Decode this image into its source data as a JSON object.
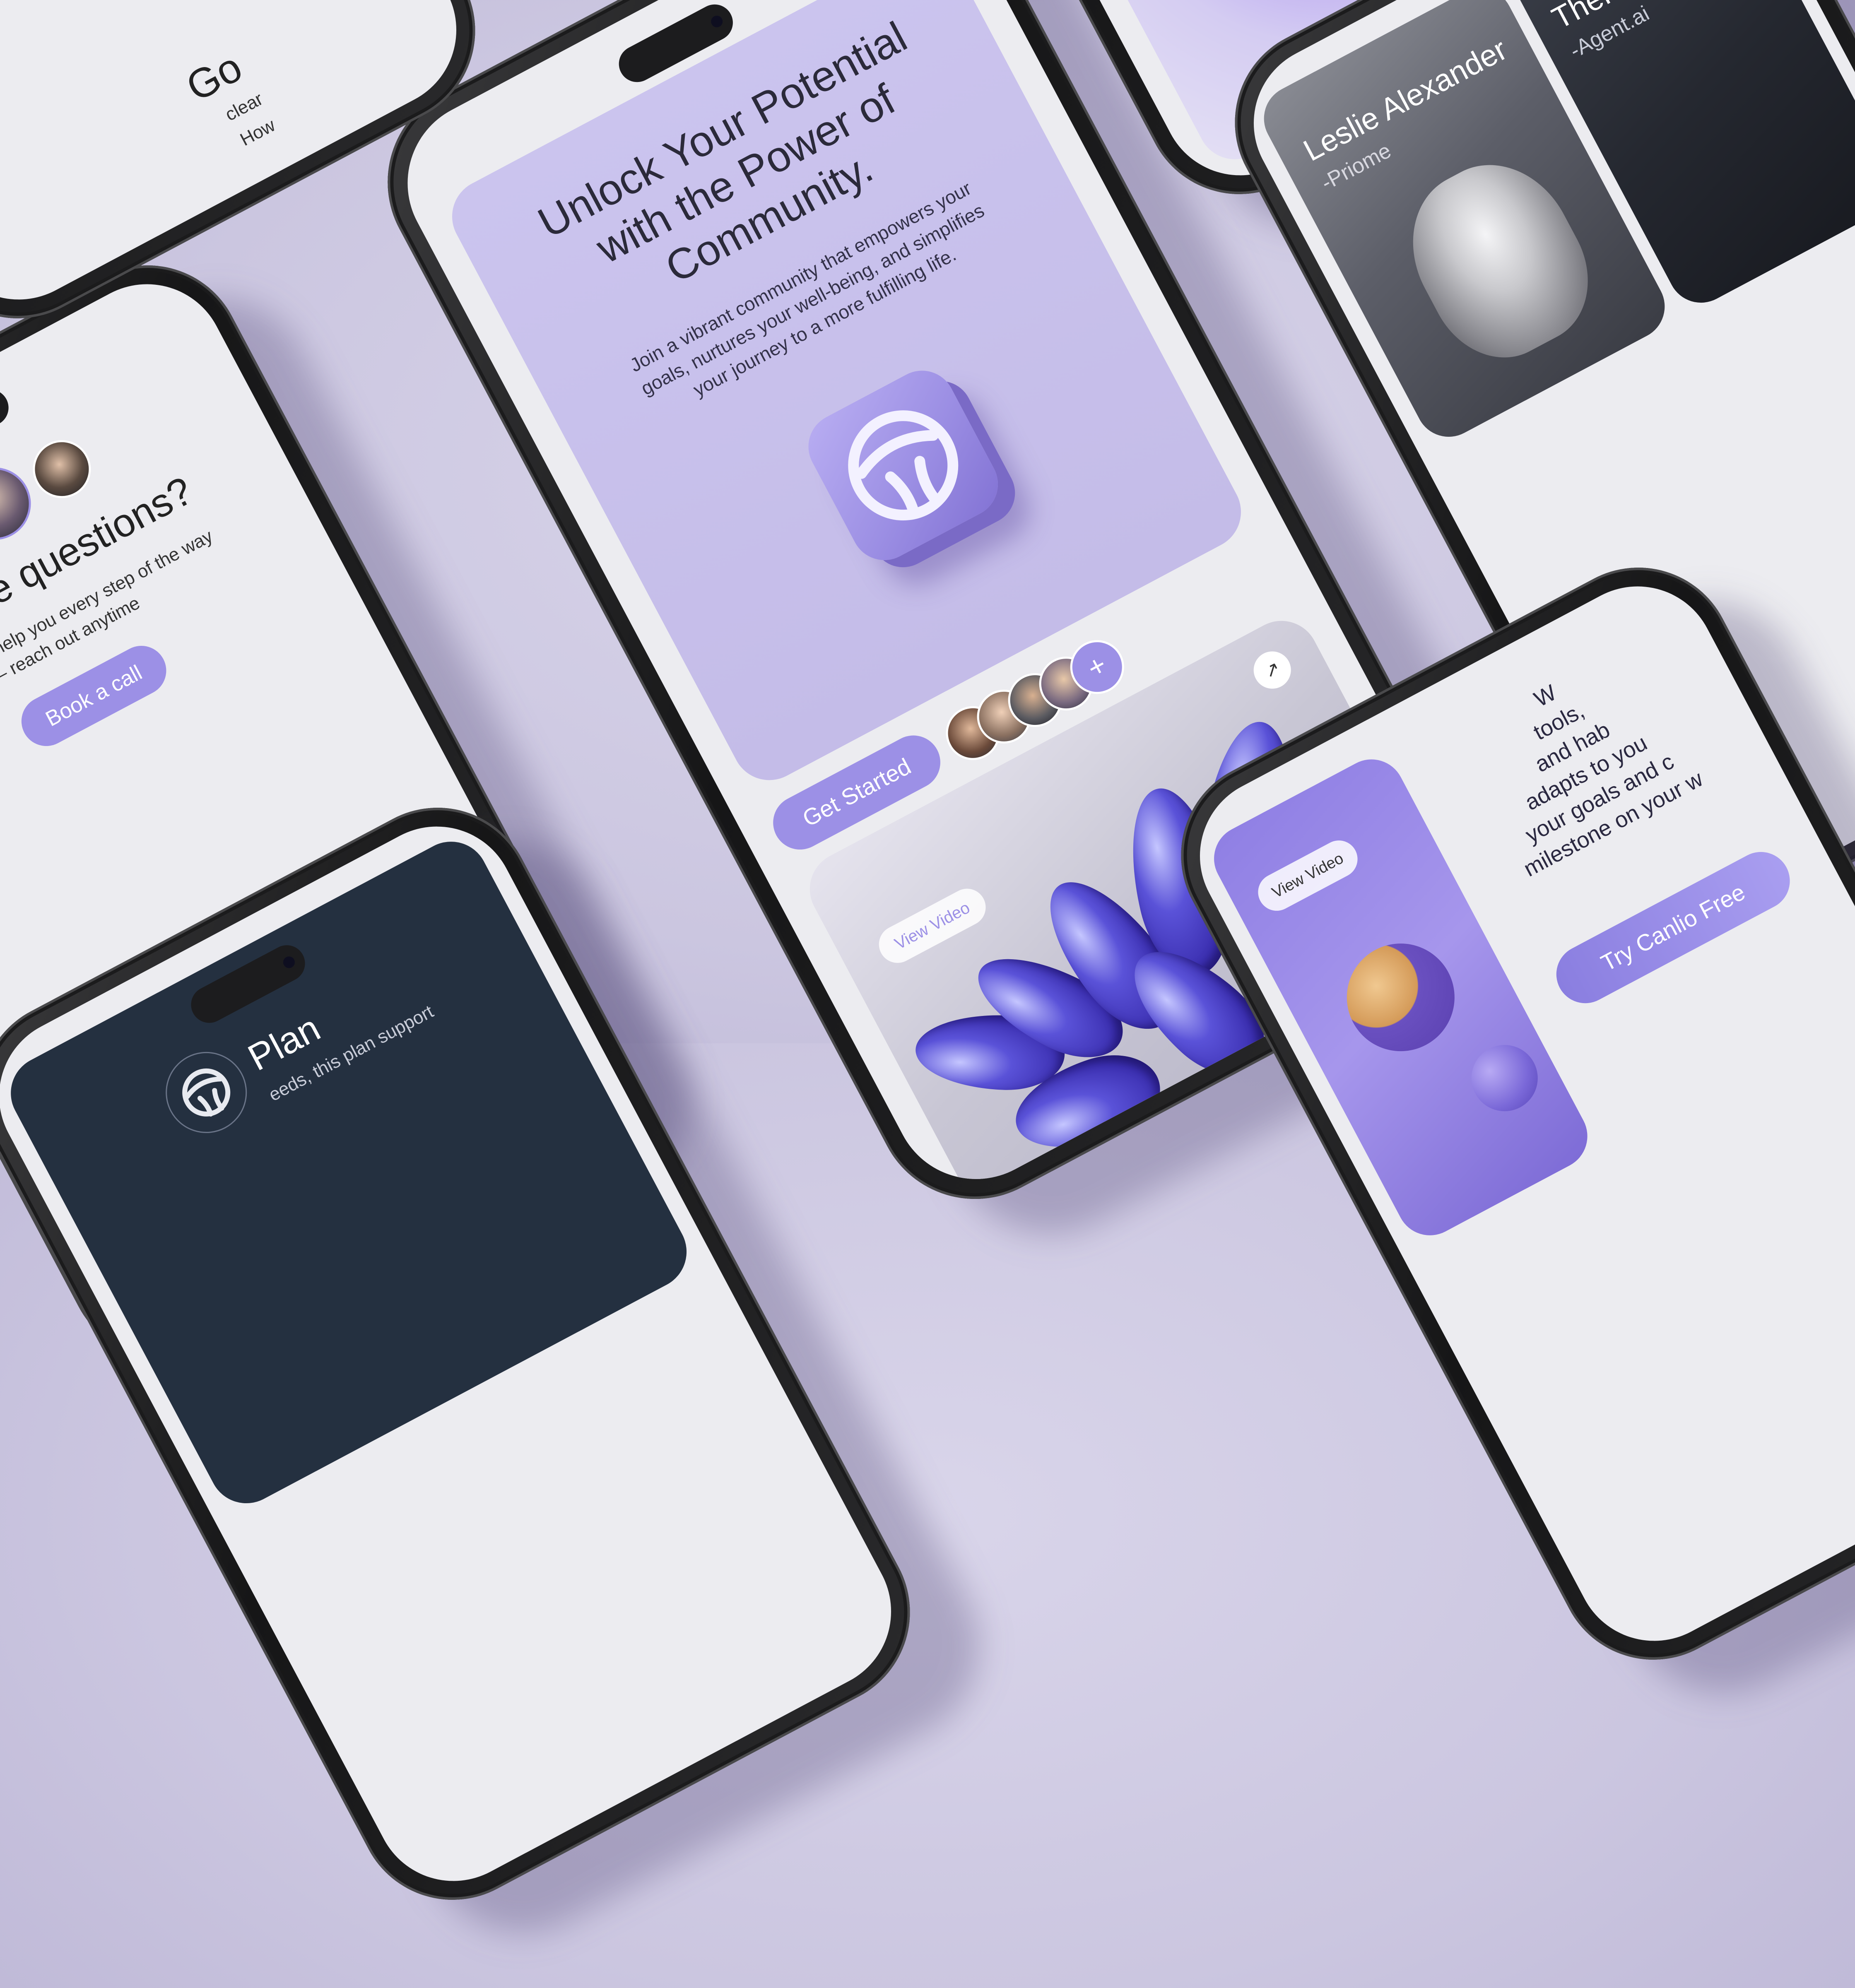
{
  "colors": {
    "background": "#cdc8e2",
    "accent": "#9c90e6",
    "card": "#c7c0ea",
    "screen": "#ececf0",
    "dark_screen": "#243040"
  },
  "center_phone": {
    "headline": "Unlock Your Potential with the Power of Community.",
    "subtext": "Join a vibrant community that empowers your goals, nurtures your well-being, and simplifies your journey to a more fulfilling life.",
    "cta_label": "Get Started",
    "add_label": "+",
    "view_video_label": "View Video",
    "arrow_label": "↗",
    "app_icon": "community-logo-icon"
  },
  "left_phone": {
    "heading": "Still have questions?",
    "subtext": "We're here to help you every step of the way — reach out anytime",
    "button_label": "Book a call"
  },
  "right_top_phone": {
    "card1_name": "Leslie Alexander",
    "card1_role": "-Priome",
    "card2_name": "Theresa Webb",
    "card2_role": "-Agent.ai"
  },
  "top_left_phone": {
    "text_1": "Go",
    "text_2": "clear",
    "text_3": "How"
  },
  "bottom_left_phone": {
    "plan_title": "Plan",
    "plan_text": "eeds, this plan support"
  },
  "bottom_right_phone": {
    "lines": [
      "W",
      "tools,",
      "and hab",
      "adapts to you",
      "your goals and c",
      "milestone on your w"
    ],
    "cta_label": "Try Canlio Free",
    "view_video_label": "View Video"
  }
}
